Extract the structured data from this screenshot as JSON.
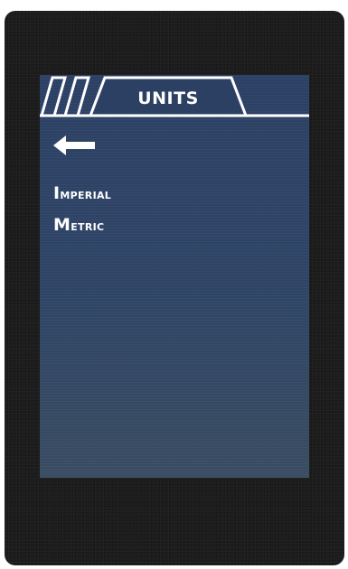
{
  "header": {
    "title": "UNITS"
  },
  "navigation": {
    "back_icon": "left-arrow-icon"
  },
  "options": [
    {
      "label": "Imperial"
    },
    {
      "label": "Metric"
    }
  ],
  "colors": {
    "screen_background": "#2b4063",
    "device_bezel": "#1c1c1c",
    "text": "#ffffff"
  }
}
